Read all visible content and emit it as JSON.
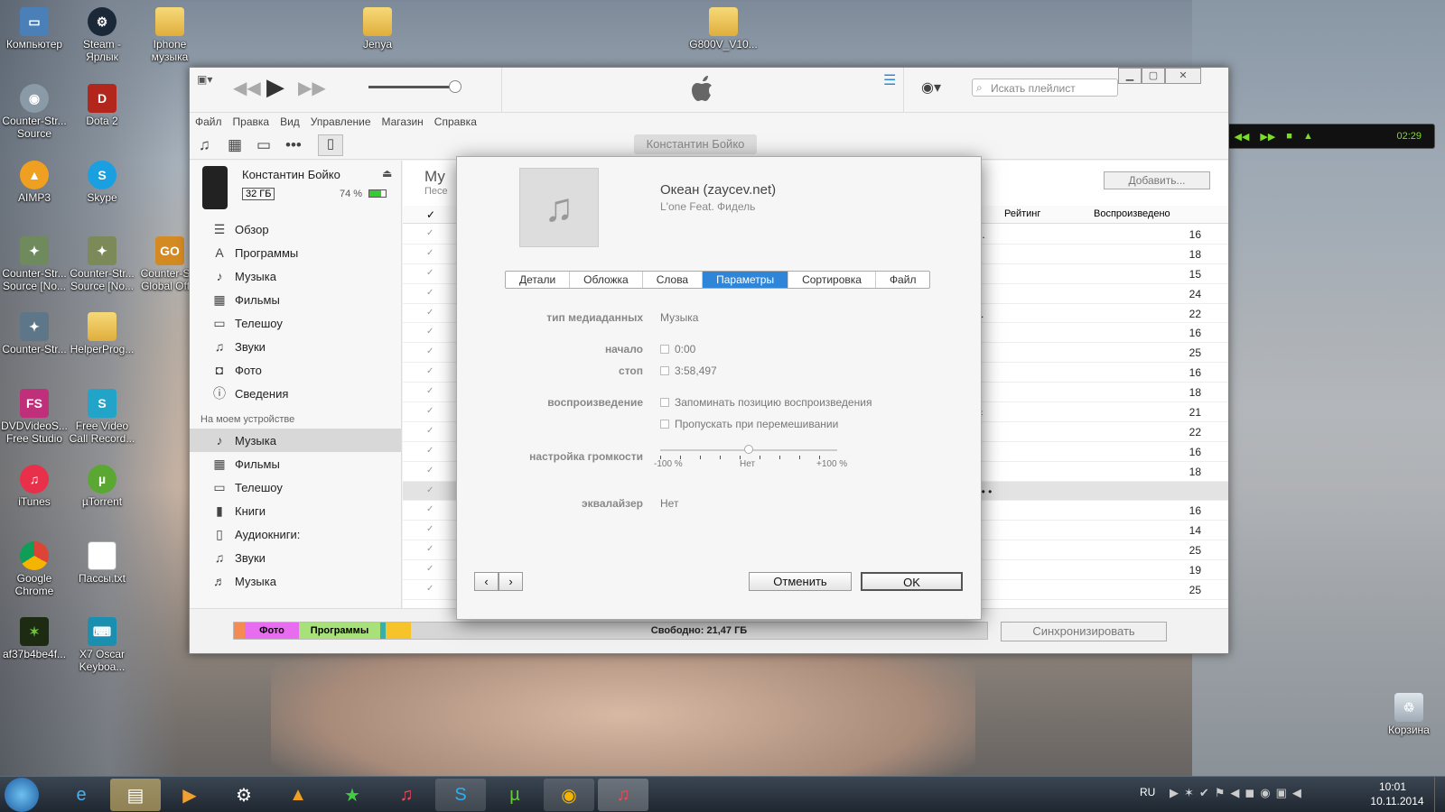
{
  "desktop_icons": [
    {
      "label": "Компьютер",
      "icon": "computer-icon"
    },
    {
      "label": "Steam - Ярлык",
      "icon": "steam-icon"
    },
    {
      "label": "Iphone музыка",
      "icon": "folder-icon"
    },
    {
      "label": "Jenya",
      "icon": "folder-icon"
    },
    {
      "label": "G800V_V10...",
      "icon": "folder-icon"
    },
    {
      "label": "Counter-Str... Source",
      "icon": "cs-icon"
    },
    {
      "label": "Dota 2",
      "icon": "dota-icon"
    },
    {
      "label": "AIMP3",
      "icon": "aimp-icon"
    },
    {
      "label": "Skype",
      "icon": "skype-icon"
    },
    {
      "label": "Counter-Str... Source [No...",
      "icon": "cs-icon"
    },
    {
      "label": "Counter-Str... Source [No...",
      "icon": "cs-icon"
    },
    {
      "label": "Counter-S... Global Off...",
      "icon": "csgo-icon"
    },
    {
      "label": "Counter-Str...",
      "icon": "cs-icon"
    },
    {
      "label": "HelperProg...",
      "icon": "folder-icon"
    },
    {
      "label": "DVDVideoS... Free Studio",
      "icon": "dvd-icon"
    },
    {
      "label": "Free Video Call Record...",
      "icon": "record-icon"
    },
    {
      "label": "iTunes",
      "icon": "itunes-icon"
    },
    {
      "label": "µTorrent",
      "icon": "utorrent-icon"
    },
    {
      "label": "Google Chrome",
      "icon": "chrome-icon"
    },
    {
      "label": "Пассы.txt",
      "icon": "txt-icon"
    },
    {
      "label": "af37b4be4f...",
      "icon": "image-icon"
    },
    {
      "label": "X7 Oscar Keyboa...",
      "icon": "keyboard-icon"
    },
    {
      "label": "Корзина",
      "icon": "recycle-bin-icon"
    }
  ],
  "itunes": {
    "menu": [
      "Файл",
      "Правка",
      "Вид",
      "Управление",
      "Магазин",
      "Справка"
    ],
    "search_placeholder": "Искать плейлист",
    "device_button": "Константин Бойко",
    "device": {
      "name": "Константин Бойко",
      "capacity": "32 ГБ",
      "battery": "74 %"
    },
    "sidebar_top": [
      "Обзор",
      "Программы",
      "Музыка",
      "Фильмы",
      "Телешоу",
      "Звуки",
      "Фото",
      "Сведения"
    ],
    "sidebar_head": "На моем устройстве",
    "sidebar_device": [
      "Музыка",
      "Фильмы",
      "Телешоу",
      "Книги",
      "Аудиокниги:",
      "Звуки",
      "Музыка"
    ],
    "list_title": "Му",
    "list_sub": "Песе",
    "add_button": "Добавить...",
    "col_rating": "Рейтинг",
    "col_plays": "Воспроизведено",
    "rows": [
      {
        "text": "her...",
        "plays": "16"
      },
      {
        "text": "",
        "plays": "18"
      },
      {
        "text": "",
        "plays": "15"
      },
      {
        "text": "",
        "plays": "24"
      },
      {
        "text": "Ho...",
        "plays": "22"
      },
      {
        "text": "use",
        "plays": "16"
      },
      {
        "text": "",
        "plays": "25"
      },
      {
        "text": "o",
        "plays": "16"
      },
      {
        "text": "n",
        "plays": "18"
      },
      {
        "text": "lusic",
        "plays": "21"
      },
      {
        "text": "",
        "plays": "22"
      },
      {
        "text": "",
        "plays": "16"
      },
      {
        "text": "",
        "plays": "18"
      },
      {
        "text": "• • • • •",
        "plays": ""
      },
      {
        "text": "",
        "plays": "16"
      },
      {
        "text": "sic",
        "plays": "14"
      },
      {
        "text": "o /...",
        "plays": "25"
      },
      {
        "text": "",
        "plays": "19"
      },
      {
        "text": "n",
        "plays": "25"
      }
    ],
    "storage": {
      "photo": "Фото",
      "apps": "Программы",
      "free": "Свободно: 21,47 ГБ",
      "sync": "Синхронизировать"
    }
  },
  "dialog": {
    "song": "Океан (zaycev.net)",
    "artist": "L'one Feat. Фидель",
    "tabs": [
      "Детали",
      "Обложка",
      "Слова",
      "Параметры",
      "Сортировка",
      "Файл"
    ],
    "active_tab": "Параметры",
    "media_type_label": "тип медиаданных",
    "media_type": "Музыка",
    "start_label": "начало",
    "start": "0:00",
    "stop_label": "стоп",
    "stop": "3:58,497",
    "playback_label": "воспроизведение",
    "remember": "Запоминать позицию воспроизведения",
    "skip": "Пропускать при перемешивании",
    "volume_label": "настройка громкости",
    "vol_min": "-100 %",
    "vol_mid": "Нет",
    "vol_max": "+100 %",
    "volume_level": 0.5,
    "eq_label": "эквалайзер",
    "eq": "Нет",
    "cancel": "Отменить",
    "ok": "OK"
  },
  "player": {
    "time": "02:29"
  },
  "taskbar": {
    "lang": "RU",
    "time": "10:01",
    "date": "10.11.2014"
  }
}
